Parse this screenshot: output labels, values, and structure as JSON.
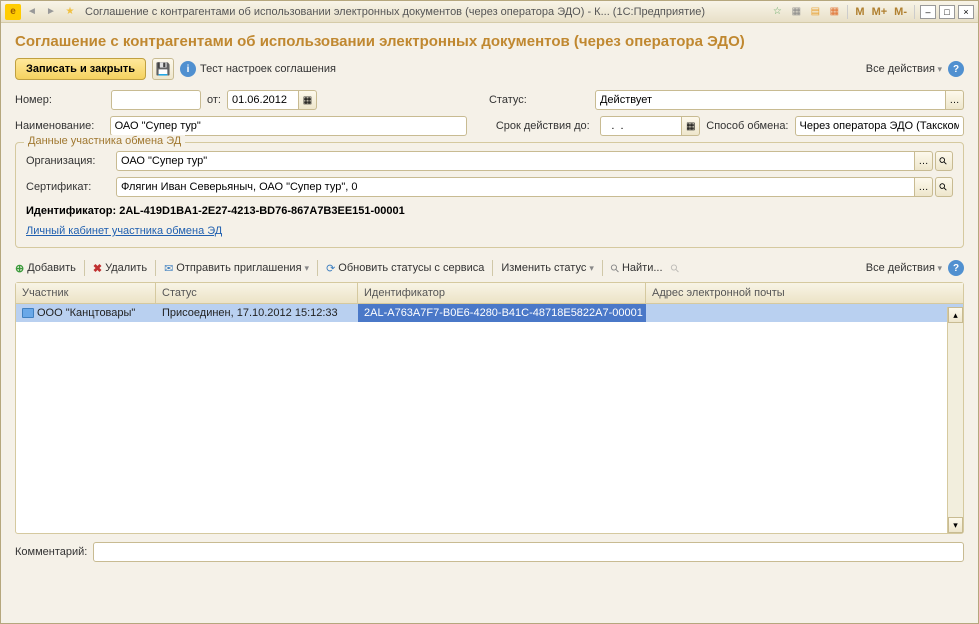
{
  "titlebar": {
    "logo": "1C",
    "title": "Соглашение с контрагентами об использовании электронных документов (через оператора ЭДО) - К...  (1С:Предприятие)",
    "m_buttons": [
      "M",
      "M+",
      "M-"
    ]
  },
  "page_title": "Соглашение с контрагентами об использовании электронных документов (через оператора ЭДО)",
  "toolbar": {
    "save_close": "Записать и закрыть",
    "test_settings": "Тест настроек соглашения",
    "all_actions": "Все действия"
  },
  "form": {
    "number_label": "Номер:",
    "number_value": "",
    "from_label": "от:",
    "date_value": "01.06.2012",
    "status_label": "Статус:",
    "status_value": "Действует",
    "name_label": "Наименование:",
    "name_value": "ОАО \"Супер тур\"",
    "valid_until_label": "Срок действия до:",
    "valid_until_value": "  .  .    ",
    "exchange_method_label": "Способ обмена:",
    "exchange_method_value": "Через оператора ЭДО (Такском)"
  },
  "participant": {
    "legend": "Данные участника обмена ЭД",
    "org_label": "Организация:",
    "org_value": "ОАО \"Супер тур\"",
    "cert_label": "Сертификат:",
    "cert_value": "Флягин Иван Северьяныч, ОАО \"Супер тур\", 0",
    "id_label": "Идентификатор:",
    "id_value": "2AL-419D1BA1-2E27-4213-BD76-867A7B3EE151-00001",
    "cabinet_link": "Личный кабинет участника обмена ЭД"
  },
  "table_toolbar": {
    "add": "Добавить",
    "delete": "Удалить",
    "send_invites": "Отправить приглашения",
    "refresh_status": "Обновить статусы с сервиса",
    "change_status": "Изменить статус",
    "find": "Найти...",
    "all_actions": "Все действия"
  },
  "table": {
    "columns": {
      "participant": "Участник",
      "status": "Статус",
      "identifier": "Идентификатор",
      "email": "Адрес электронной почты"
    },
    "rows": [
      {
        "participant": "ООО \"Канцтовары\"",
        "status": "Присоединен, 17.10.2012 15:12:33",
        "identifier": "2AL-A763A7F7-B0E6-4280-B41C-48718E5822A7-00001",
        "email": ""
      }
    ]
  },
  "footer": {
    "comment_label": "Комментарий:",
    "comment_value": ""
  }
}
